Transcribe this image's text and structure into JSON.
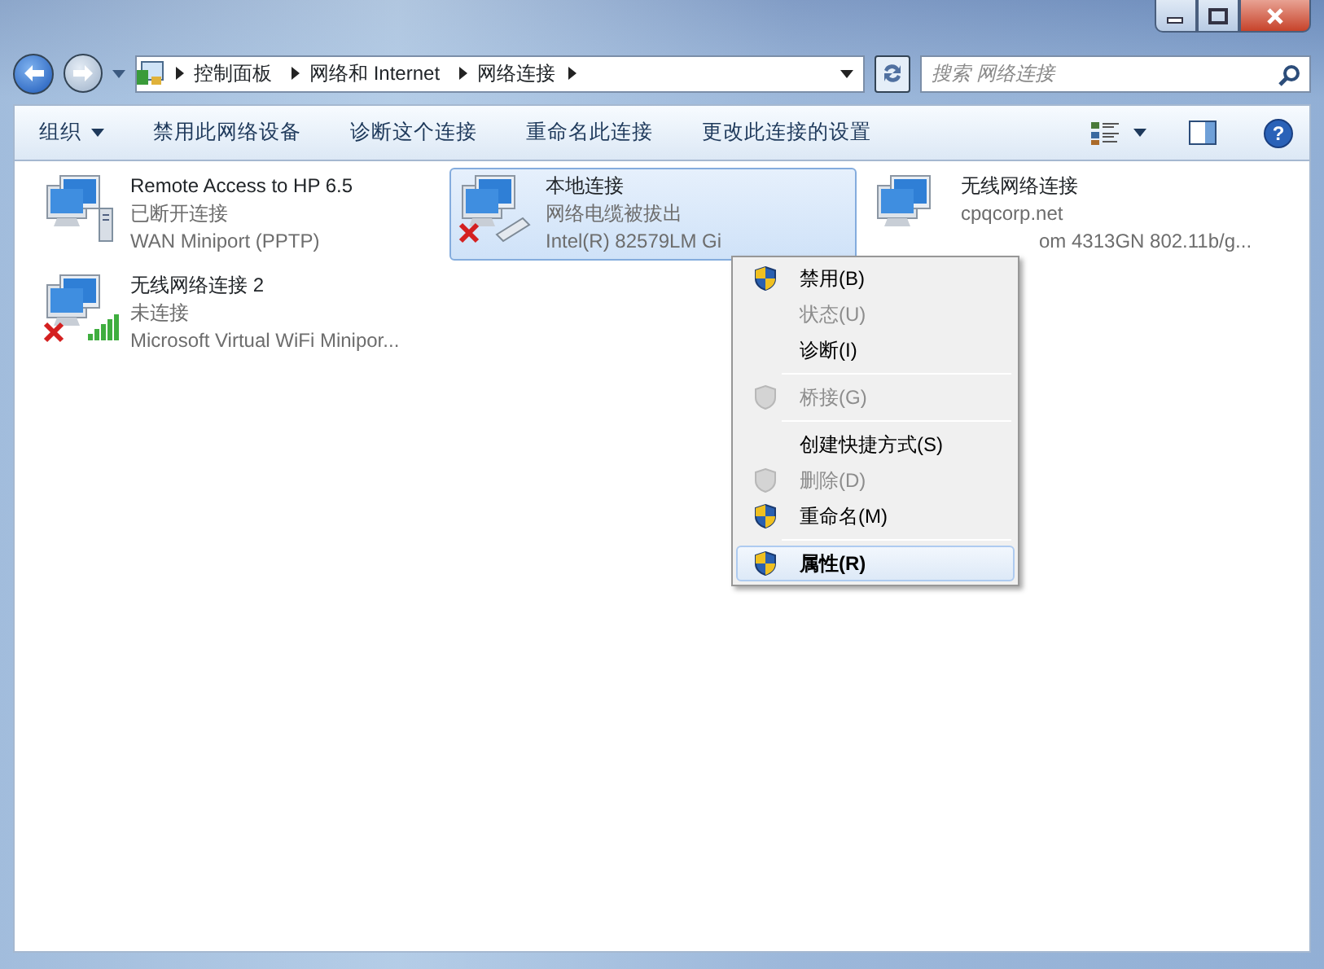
{
  "address_bar": {
    "breadcrumbs": [
      "控制面板",
      "网络和 Internet",
      "网络连接"
    ]
  },
  "search": {
    "placeholder": "搜索 网络连接"
  },
  "toolbar": {
    "buttons": [
      {
        "label": "组织",
        "dropdown": true
      },
      {
        "label": "禁用此网络设备",
        "dropdown": false
      },
      {
        "label": "诊断这个连接",
        "dropdown": false
      },
      {
        "label": "重命名此连接",
        "dropdown": false
      },
      {
        "label": "更改此连接的设置",
        "dropdown": false
      }
    ],
    "help": "?"
  },
  "connections": [
    {
      "name": "Remote Access to HP 6.5",
      "status": "已断开连接",
      "device": "WAN Miniport (PPTP)",
      "kind": "wan",
      "disconnected": false,
      "selected": false
    },
    {
      "name": "本地连接",
      "status": "网络电缆被拔出",
      "device": "Intel(R) 82579LM Gi",
      "kind": "ethernet",
      "disconnected": true,
      "selected": true
    },
    {
      "name": "无线网络连接",
      "status": "cpqcorp.net",
      "device": "om 4313GN 802.11b/g...",
      "kind": "covered",
      "disconnected": false,
      "selected": false
    },
    {
      "name": "无线网络连接 2",
      "status": "未连接",
      "device": "Microsoft Virtual WiFi Minipor...",
      "kind": "wifi",
      "disconnected": true,
      "selected": false
    }
  ],
  "context_menu": [
    {
      "kind": "item",
      "label": "禁用(B)",
      "shield": true,
      "disabled": false,
      "default": false,
      "selected": false
    },
    {
      "kind": "item",
      "label": "状态(U)",
      "shield": false,
      "disabled": true,
      "default": false,
      "selected": false
    },
    {
      "kind": "item",
      "label": "诊断(I)",
      "shield": false,
      "disabled": false,
      "default": false,
      "selected": false
    },
    {
      "kind": "separator"
    },
    {
      "kind": "item",
      "label": "桥接(G)",
      "shield": true,
      "disabled": true,
      "default": false,
      "selected": false
    },
    {
      "kind": "separator"
    },
    {
      "kind": "item",
      "label": "创建快捷方式(S)",
      "shield": false,
      "disabled": false,
      "default": false,
      "selected": false
    },
    {
      "kind": "item",
      "label": "删除(D)",
      "shield": true,
      "disabled": true,
      "default": false,
      "selected": false
    },
    {
      "kind": "item",
      "label": "重命名(M)",
      "shield": true,
      "disabled": false,
      "default": false,
      "selected": false
    },
    {
      "kind": "separator"
    },
    {
      "kind": "item",
      "label": "属性(R)",
      "shield": true,
      "disabled": false,
      "default": true,
      "selected": true
    }
  ]
}
